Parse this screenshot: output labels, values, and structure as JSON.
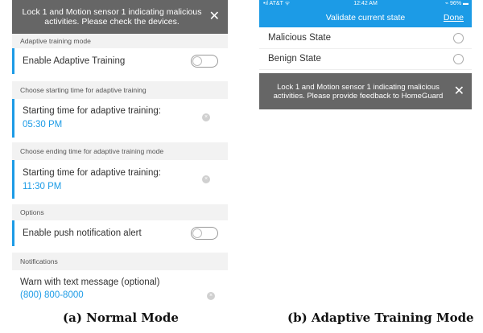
{
  "left": {
    "toast": "Lock 1 and Motion sensor 1 indicating malicious activities. Please check the devices.",
    "close_glyph": "✕",
    "sections": {
      "adaptive_mode": "Adaptive training mode",
      "starting_time": "Choose starting time for adaptive training",
      "ending_time": "Choose ending time for adaptive training mode",
      "options": "Options",
      "notifications": "Notifications"
    },
    "enable_adaptive_training": {
      "label": "Enable Adaptive Training",
      "on": false
    },
    "start_time": {
      "label": "Starting time for adaptive training:",
      "value": "05:30 PM"
    },
    "end_time": {
      "label": "Starting time for adaptive training:",
      "value": "11:30 PM"
    },
    "push_notification": {
      "label": "Enable push notification alert",
      "on": false
    },
    "text_message": {
      "label": "Warn with text message (optional)",
      "value": "(800) 800-8000"
    },
    "clear_glyph": "×",
    "caption": "(a) Normal Mode"
  },
  "right": {
    "status": {
      "carrier": "•ıl AT&T ᯤ",
      "time": "12:42 AM",
      "battery": "⌁ 96% ▬"
    },
    "nav_title": "Validate current state",
    "done": "Done",
    "options": [
      {
        "label": "Malicious State",
        "selected": false
      },
      {
        "label": "Benign State",
        "selected": false
      }
    ],
    "toast": "Lock 1 and Motion sensor 1 indicating malicious activities. Please provide feedback to HomeGuard",
    "close_glyph": "✕",
    "caption": "(b) Adaptive Training Mode"
  },
  "colors": {
    "accent": "#1c9be6",
    "toast_bg": "#666666",
    "section_bg": "#f2f2f2"
  },
  "icons": [
    "close-icon",
    "toggle-switch",
    "clear-icon",
    "radio-button",
    "wifi-icon",
    "battery-icon"
  ]
}
